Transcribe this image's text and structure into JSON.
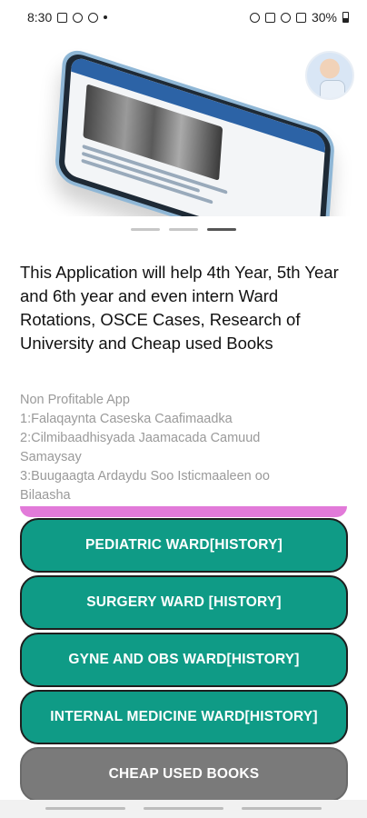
{
  "status_bar": {
    "time": "8:30",
    "battery": "30%"
  },
  "hero": {
    "image_name": "phone-mockup-xray",
    "avatar_name": "doctor-avatar"
  },
  "pager": {
    "count": 3,
    "active_index": 2
  },
  "headline": "This Application will help 4th Year, 5th Year and 6th year and even intern Ward Rotations, OSCE Cases, Research of University and Cheap used Books",
  "info": {
    "title": "Non Profitable App",
    "items": [
      "1:Falaqaynta Caseska Caafimaadka",
      "2:Cilmibaadhisyada Jaamacada Camuud Samaysay",
      "3:Buugaagta Ardaydu Soo Isticmaaleen oo Bilaasha"
    ]
  },
  "buttons": {
    "pediatric": "PEDIATRIC WARD[HISTORY]",
    "surgery": "SURGERY WARD [HISTORY]",
    "gyne": "GYNE AND OBS WARD[HISTORY]",
    "internal": "INTERNAL MEDICINE WARD[HISTORY]",
    "books": "CHEAP USED BOOKS"
  },
  "colors": {
    "teal": "#0f9b86",
    "gray": "#7a7a7a",
    "accent_pink": "#e27ad9"
  }
}
